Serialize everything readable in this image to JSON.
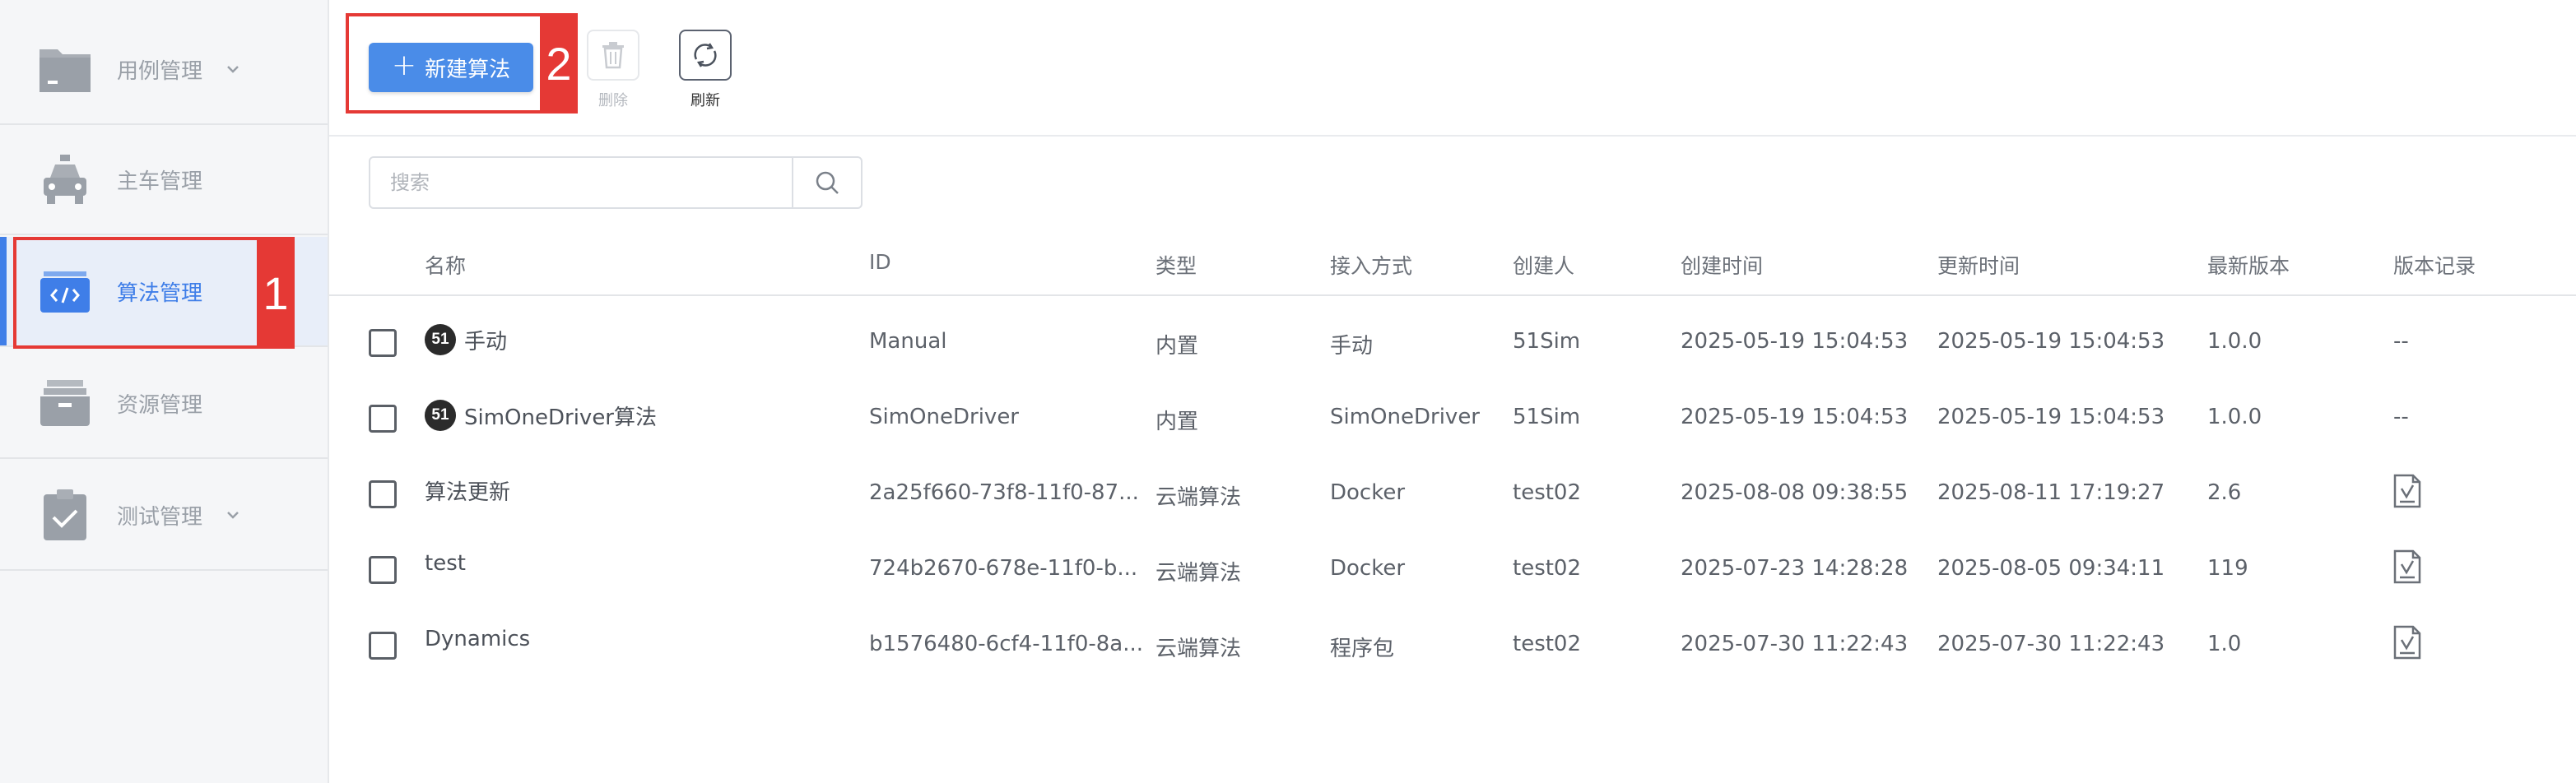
{
  "sidebar": {
    "items": [
      {
        "label": "用例管理",
        "icon": "folder-icon",
        "has_chevron": true
      },
      {
        "label": "主车管理",
        "icon": "car-icon",
        "has_chevron": false
      },
      {
        "label": "算法管理",
        "icon": "code-icon",
        "has_chevron": false,
        "active": true
      },
      {
        "label": "资源管理",
        "icon": "archive-box-icon",
        "has_chevron": false
      },
      {
        "label": "测试管理",
        "icon": "clipboard-check-icon",
        "has_chevron": true
      }
    ]
  },
  "annotations": {
    "one": "1",
    "two": "2"
  },
  "toolbar": {
    "new_label": "新建算法",
    "delete_label": "删除",
    "refresh_label": "刷新"
  },
  "search": {
    "placeholder": "搜索"
  },
  "table": {
    "headers": [
      "名称",
      "ID",
      "类型",
      "接入方式",
      "创建人",
      "创建时间",
      "更新时间",
      "最新版本",
      "版本记录"
    ],
    "rows": [
      {
        "logo": "51",
        "name": "手动",
        "id": "Manual",
        "type": "内置",
        "access": "手动",
        "creator": "51Sim",
        "created": "2025-05-19 15:04:53",
        "updated": "2025-05-19 15:04:53",
        "version": "1.0.0",
        "history": "--"
      },
      {
        "logo": "51",
        "name": "SimOneDriver算法",
        "id": "SimOneDriver",
        "type": "内置",
        "access": "SimOneDriver",
        "creator": "51Sim",
        "created": "2025-05-19 15:04:53",
        "updated": "2025-05-19 15:04:53",
        "version": "1.0.0",
        "history": "--"
      },
      {
        "logo": "",
        "name": "算法更新",
        "id": "2a25f660-73f8-11f0-87...",
        "type": "云端算法",
        "access": "Docker",
        "creator": "test02",
        "created": "2025-08-08 09:38:55",
        "updated": "2025-08-11 17:19:27",
        "version": "2.6",
        "history": ""
      },
      {
        "logo": "",
        "name": "test",
        "id": "724b2670-678e-11f0-b...",
        "type": "云端算法",
        "access": "Docker",
        "creator": "test02",
        "created": "2025-07-23 14:28:28",
        "updated": "2025-08-05 09:34:11",
        "version": "119",
        "history": ""
      },
      {
        "logo": "",
        "name": "Dynamics",
        "id": "b1576480-6cf4-11f0-8a...",
        "type": "云端算法",
        "access": "程序包",
        "creator": "test02",
        "created": "2025-07-30 11:22:43",
        "updated": "2025-07-30 11:22:43",
        "version": "1.0",
        "history": ""
      }
    ]
  },
  "colors": {
    "accent": "#3f7ee8",
    "annotation": "#e53935",
    "primary_button": "#4a8ce8"
  }
}
